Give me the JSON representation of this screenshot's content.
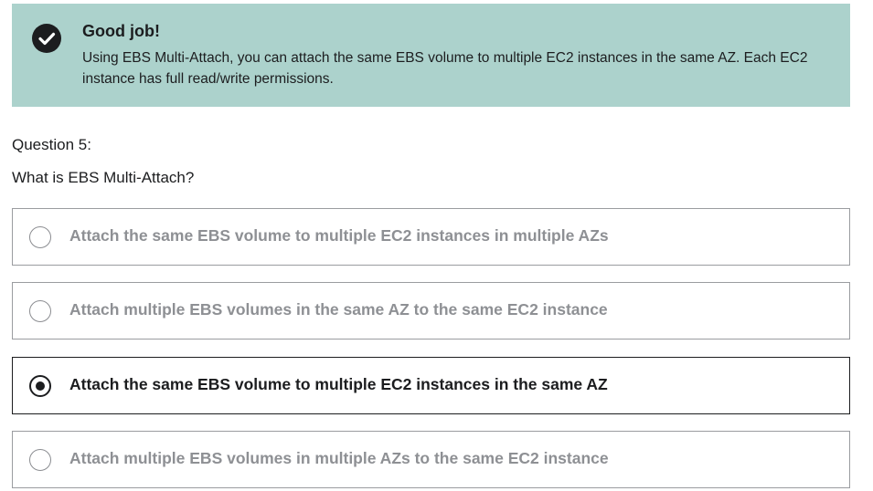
{
  "feedback": {
    "icon": "check-circle-icon",
    "title": "Good job!",
    "message": "Using EBS Multi-Attach, you can attach the same EBS volume to multiple EC2 instances in the same AZ. Each EC2 instance has full read/write permissions.",
    "background_color": "#acd2cc"
  },
  "question": {
    "number_label": "Question 5:",
    "text": "What is EBS Multi-Attach?"
  },
  "options": [
    {
      "label": "Attach the same EBS volume to multiple EC2 instances in multiple AZs",
      "selected": false
    },
    {
      "label": "Attach multiple EBS volumes in the same AZ to the same EC2 instance",
      "selected": false
    },
    {
      "label": "Attach the same EBS volume to multiple EC2 instances in the same AZ",
      "selected": true
    },
    {
      "label": "Attach multiple EBS volumes in multiple AZs to the same EC2 instance",
      "selected": false
    }
  ]
}
